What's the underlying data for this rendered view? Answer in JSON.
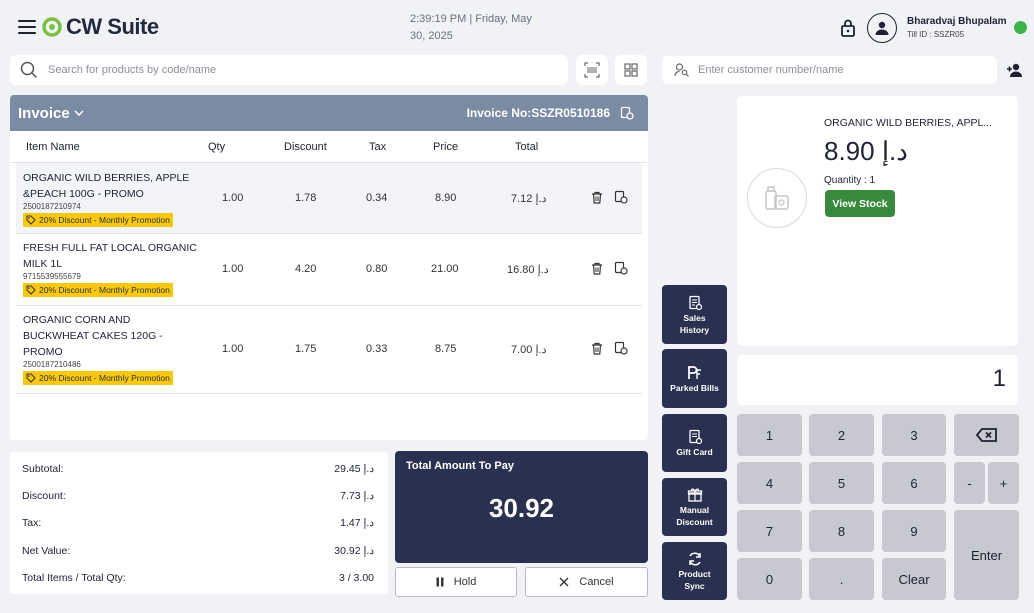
{
  "header": {
    "app_name": "CW Suite",
    "datetime_line1": "2:39:19 PM | Friday, May",
    "datetime_line2": "30, 2025",
    "user_name": "Bharadvaj Bhupalam",
    "till_id": "Till ID : SSZR05",
    "status_color": "#3cb44b"
  },
  "search": {
    "placeholder": "Search for products by code/name"
  },
  "customer": {
    "placeholder": "Enter customer number/name"
  },
  "invoice": {
    "title": "Invoice",
    "number": "Invoice No:SSZR0510186",
    "columns": [
      "Item Name",
      "Qty",
      "Discount",
      "Tax",
      "Price",
      "Total"
    ],
    "items": [
      {
        "name_line1": "ORGANIC WILD BERRIES, APPLE",
        "name_line2": "&PEACH 100G - PROMO",
        "name_line3": "",
        "sku": "2500187210974",
        "promo": "20% Discount - Monthly Promotion",
        "qty": "1.00",
        "discount": "1.78",
        "tax": "0.34",
        "price": "8.90",
        "total": "د.إ 7.12"
      },
      {
        "name_line1": "FRESH FULL FAT LOCAL ORGANIC",
        "name_line2": "MILK 1L",
        "name_line3": "",
        "sku": "9715539555679",
        "promo": "20% Discount - Monthly Promotion",
        "qty": "1.00",
        "discount": "4.20",
        "tax": "0.80",
        "price": "21.00",
        "total": "د.إ 16.80"
      },
      {
        "name_line1": "ORGANIC CORN AND",
        "name_line2": "BUCKWHEAT CAKES 120G -",
        "name_line3": "PROMO",
        "sku": "2500187210486",
        "promo": "20% Discount - Monthly Promotion",
        "qty": "1.00",
        "discount": "1.75",
        "tax": "0.33",
        "price": "8.75",
        "total": "د.إ 7.00"
      }
    ]
  },
  "totals": {
    "subtotal_label": "Subtotal:",
    "subtotal": "د.إ 29.45",
    "discount_label": "Discount:",
    "discount": "د.إ 7.73",
    "tax_label": "Tax:",
    "tax": "د.إ 1.47",
    "net_label": "Net Value:",
    "net": "د.إ 30.92",
    "items_label": "Total Items / Total Qty:",
    "items": "3 / 3.00"
  },
  "payment": {
    "label": "Total Amount To Pay",
    "amount": "30.92",
    "hold_label": "Hold",
    "cancel_label": "Cancel"
  },
  "side_actions": [
    {
      "line1": "Sales",
      "line2": "History",
      "icon": "receipt-icon"
    },
    {
      "line1": "Parked Bills",
      "line2": "",
      "icon": "parked-icon"
    },
    {
      "line1": "Gift Card",
      "line2": "",
      "icon": "gift-card-icon"
    },
    {
      "line1": "Manual",
      "line2": "Discount",
      "icon": "gift-icon"
    },
    {
      "line1": "Product",
      "line2": "Sync",
      "icon": "sync-icon"
    }
  ],
  "product": {
    "name": "ORGANIC WILD BERRIES, APPL...",
    "price": "8.90 د.إ",
    "quantity": "Quantity : 1",
    "view_stock": "View Stock"
  },
  "keypad": {
    "display": "1",
    "keys": [
      "1",
      "2",
      "3",
      "4",
      "5",
      "6",
      "7",
      "8",
      "9",
      "0",
      ".",
      "Clear"
    ],
    "minus": "-",
    "plus": "+",
    "enter": "Enter"
  }
}
